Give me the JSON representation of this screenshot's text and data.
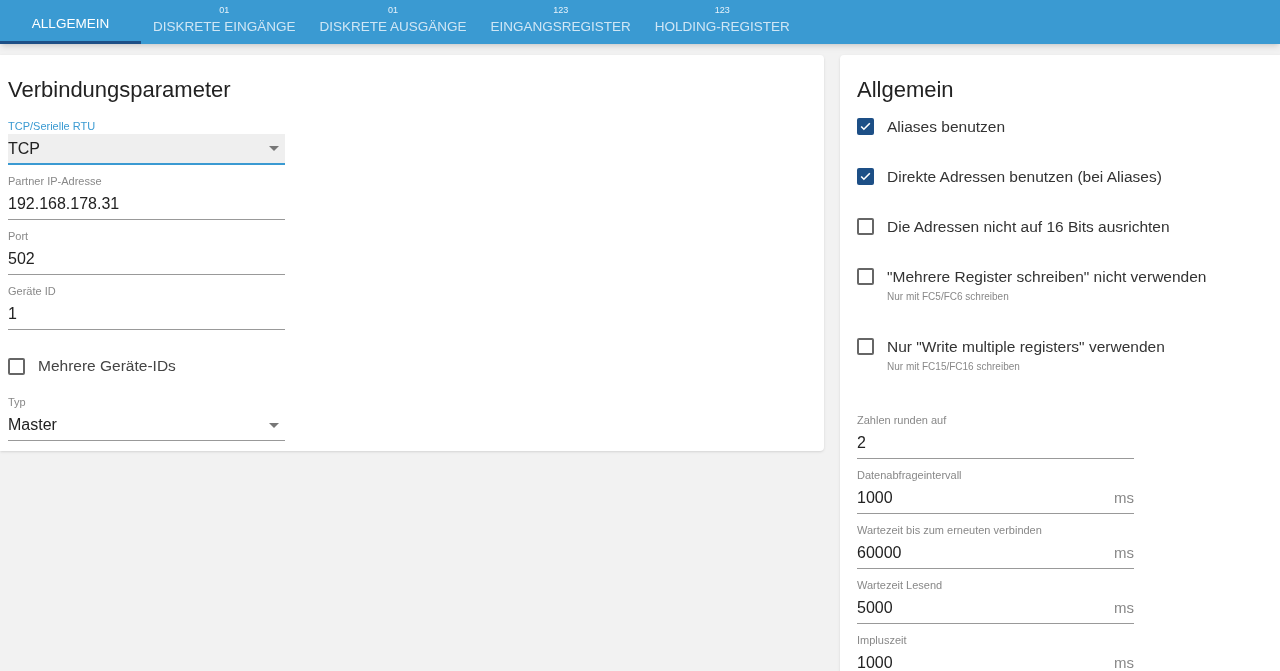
{
  "tabs": [
    {
      "label": "ALLGEMEIN",
      "selected": true
    },
    {
      "label": "DISKRETE EINGÄNGE",
      "badge": "01",
      "selected": false
    },
    {
      "label": "DISKRETE AUSGÄNGE",
      "badge": "01",
      "selected": false
    },
    {
      "label": "EINGANGSREGISTER",
      "badge": "123",
      "selected": false
    },
    {
      "label": "HOLDING-REGISTER",
      "badge": "123",
      "selected": false
    }
  ],
  "connection": {
    "title": "Verbindungsparameter",
    "items": [
      {
        "kind": "select",
        "label": "TCP/Serielle RTU",
        "value": "TCP",
        "focused": true
      },
      {
        "kind": "text",
        "label": "Partner IP-Adresse",
        "value": "192.168.178.31",
        "focused": false
      },
      {
        "kind": "text",
        "label": "Port",
        "value": "502",
        "focused": false
      },
      {
        "kind": "text",
        "label": "Geräte ID",
        "value": "1",
        "focused": false
      },
      {
        "kind": "checkbox",
        "label": "Mehrere Geräte-IDs",
        "checked": false
      },
      {
        "kind": "select",
        "label": "Typ",
        "value": "Master",
        "focused": false
      }
    ]
  },
  "general": {
    "title": "Allgemein",
    "options": [
      {
        "label": "Aliases benutzen",
        "checked": true
      },
      {
        "label": "Direkte Adressen benutzen (bei Aliases)",
        "checked": true
      },
      {
        "label": "Die Adressen nicht auf 16 Bits ausrichten",
        "checked": false
      },
      {
        "label": "\"Mehrere Register schreiben\" nicht verwenden",
        "hint": "Nur mit FC5/FC6 schreiben",
        "checked": false
      },
      {
        "label": "Nur \"Write multiple registers\" verwenden",
        "hint": "Nur mit FC15/FC16 schreiben",
        "checked": false
      }
    ],
    "fields": [
      {
        "label": "Zahlen runden auf",
        "value": "2"
      },
      {
        "label": "Datenabfrageintervall",
        "value": "1000",
        "unit": "ms"
      },
      {
        "label": "Wartezeit bis zum erneuten verbinden",
        "value": "60000",
        "unit": "ms"
      },
      {
        "label": "Wartezeit Lesend",
        "value": "5000",
        "unit": "ms"
      },
      {
        "label": "Impluszeit",
        "value": "1000",
        "unit": "ms"
      }
    ]
  }
}
